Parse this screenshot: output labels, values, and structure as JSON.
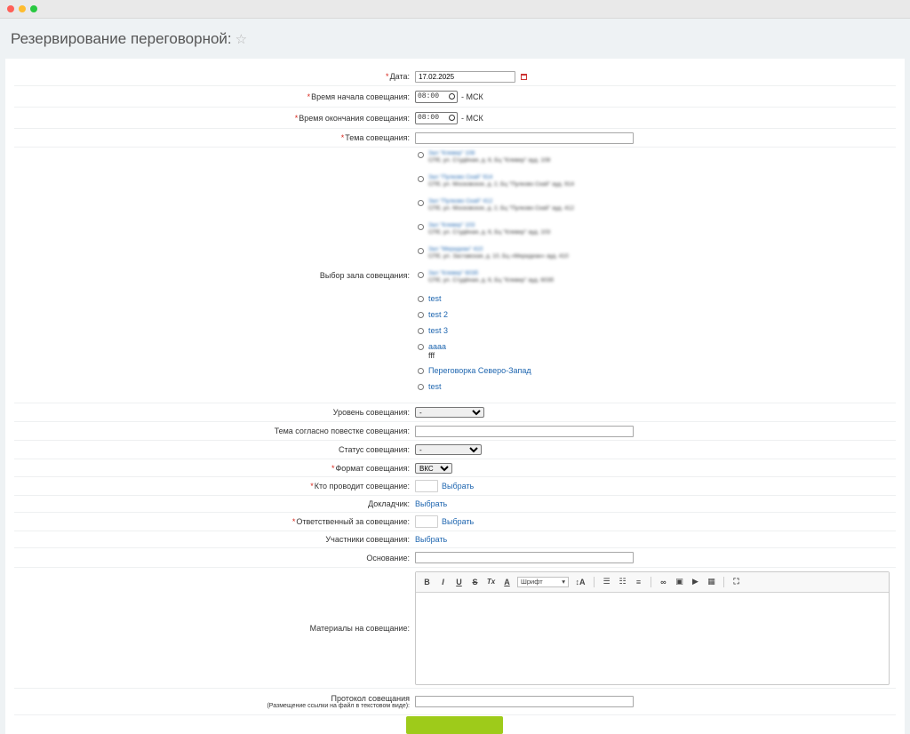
{
  "page": {
    "title": "Резервирование переговорной:"
  },
  "form": {
    "date": {
      "label": "Дата:",
      "value": "17.02.2025"
    },
    "start_time": {
      "label": "Время начала совещания:",
      "value": "08:00",
      "suffix": "- МСК"
    },
    "end_time": {
      "label": "Время окончания совещания:",
      "value": "08:00",
      "suffix": "- МСК"
    },
    "topic": {
      "label": "Тема совещания:",
      "value": ""
    },
    "room": {
      "label": "Выбор зала совещания:",
      "options": [
        {
          "name": "Зал \"Клевер\" 108",
          "address": "СПб, ул. Студёная, д. 6, Бц \"Клевер\" ауд. 108"
        },
        {
          "name": "Зал \"Пулково Скай\" 914",
          "address": "СПб, ул. Московское, д. 2, Бц \"Пулково Скай\" ауд. 914"
        },
        {
          "name": "Зал \"Пулково Скай\" 412",
          "address": "СПб, ул. Московское, д. 2, Бц \"Пулково Скай\" ауд. 412"
        },
        {
          "name": "Зал \"Клевер\" 103",
          "address": "СПб, ул. Студёная, д. 6, Бц \"Клевер\" ауд. 103"
        },
        {
          "name": "Зал \"Меридиан\" 410",
          "address": "СПб, ул. Заставская, д. 10, Бц «Меридиан» ауд. 410"
        },
        {
          "name": "Зал \"Клевер\" 603б",
          "address": "СПб, ул. Студёная, д. 6, Бц \"Клевер\" ауд. 603б"
        },
        {
          "name": "test",
          "address": ""
        },
        {
          "name": "test 2",
          "address": ""
        },
        {
          "name": "test 3",
          "address": ""
        },
        {
          "name": "аааа",
          "address": "fff"
        },
        {
          "name": "Переговорка Северо-Запад",
          "address": ""
        },
        {
          "name": "test",
          "address": ""
        }
      ]
    },
    "level": {
      "label": "Уровень совещания:",
      "value": "-"
    },
    "agenda_topic": {
      "label": "Тема согласно повестке совещания:",
      "value": ""
    },
    "status": {
      "label": "Статус совещания:",
      "value": "-"
    },
    "format": {
      "label": "Формат совещания:",
      "value": "ВКС"
    },
    "host": {
      "label": "Кто проводит совещание:",
      "link": "Выбрать"
    },
    "speaker": {
      "label": "Докладчик:",
      "link": "Выбрать"
    },
    "responsible": {
      "label": "Ответственный за совещание:",
      "link": "Выбрать"
    },
    "participants": {
      "label": "Участники совещания:",
      "link": "Выбрать"
    },
    "basis": {
      "label": "Основание:",
      "value": ""
    },
    "materials": {
      "label": "Материалы на совещание:",
      "toolbar": {
        "bold": "B",
        "italic": "I",
        "underline": "U",
        "strike": "S",
        "clear": "Tx",
        "color": "A",
        "font": "Шрифт",
        "size": "↕A"
      }
    },
    "protocol": {
      "label": "Протокол совещания",
      "note": "(Размещение ссылки на файл в текстовом виде):",
      "value": ""
    }
  },
  "icons": [
    "star-icon",
    "calendar-icon",
    "clock-icon",
    "link-icon",
    "image-icon",
    "video-icon",
    "table-icon",
    "fullscreen-icon"
  ],
  "colors": {
    "link": "#2067b0",
    "required": "#d8281d",
    "submit": "#9ecb1a"
  }
}
